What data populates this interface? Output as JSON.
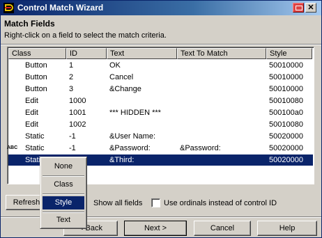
{
  "window": {
    "title": "Control Match Wizard"
  },
  "header": {
    "title": "Match Fields",
    "subtitle": "Right-click on a field to select the match criteria."
  },
  "table": {
    "columns": [
      "Class",
      "ID",
      "Text",
      "Text To Match",
      "Style"
    ],
    "rows": [
      {
        "class": "Button",
        "id": "1",
        "text": "OK",
        "match": "",
        "style": "50010000",
        "icon": ""
      },
      {
        "class": "Button",
        "id": "2",
        "text": "Cancel",
        "match": "",
        "style": "50010000",
        "icon": ""
      },
      {
        "class": "Button",
        "id": "3",
        "text": "&Change",
        "match": "",
        "style": "50010000",
        "icon": ""
      },
      {
        "class": "Edit",
        "id": "1000",
        "text": "",
        "match": "",
        "style": "50010080",
        "icon": ""
      },
      {
        "class": "Edit",
        "id": "1001",
        "text": "*** HIDDEN ***",
        "match": "",
        "style": "500100a0",
        "icon": ""
      },
      {
        "class": "Edit",
        "id": "1002",
        "text": "",
        "match": "",
        "style": "50010080",
        "icon": ""
      },
      {
        "class": "Static",
        "id": "-1",
        "text": "&User Name:",
        "match": "",
        "style": "50020000",
        "icon": ""
      },
      {
        "class": "Static",
        "id": "-1",
        "text": "&Password:",
        "match": "&Password:",
        "style": "50020000",
        "icon": "ABC"
      },
      {
        "class": "Static",
        "id": "-1",
        "text": "&Third:",
        "match": "",
        "style": "50020000",
        "icon": ""
      }
    ],
    "selected_row": 8
  },
  "controls": {
    "refresh_label": "Refresh",
    "show_all_label": "Show all fields",
    "ordinals_label": "Use  ordinals  instead  of  control ID",
    "back_label": "< Back",
    "next_label": "Next >",
    "cancel_label": "Cancel",
    "help_label": "Help"
  },
  "context_menu": {
    "items": [
      "None",
      "Class",
      "Style",
      "Text"
    ],
    "selected": "Style"
  },
  "colors": {
    "title_bar": "#0a246a",
    "selection": "#0a246a",
    "face": "#d4d0c8"
  }
}
